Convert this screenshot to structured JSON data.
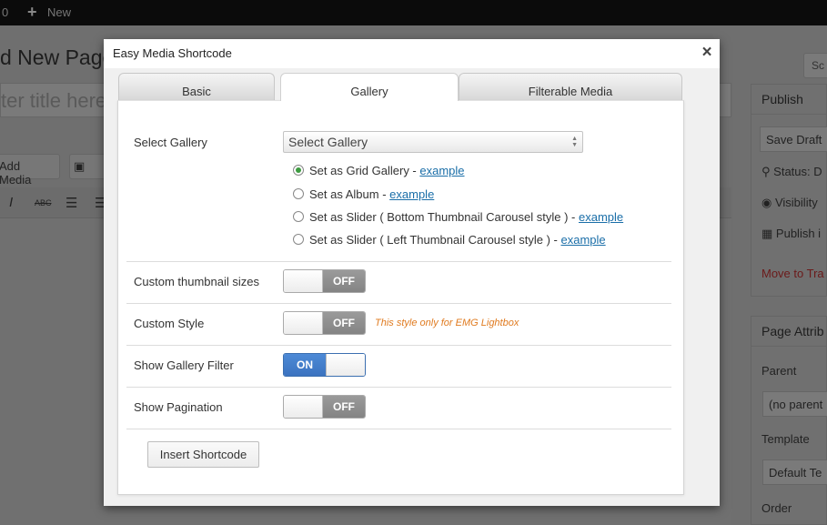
{
  "background": {
    "adminbar": {
      "count": "0",
      "new_label": "New"
    },
    "page_title": "d New Page",
    "title_placeholder": "ter title here",
    "add_media_label": "Add Media",
    "search_btn": "Sc",
    "publish_box": {
      "title": "Publish",
      "save_draft": "Save Draft",
      "status": "Status: D",
      "visibility": "Visibility",
      "publish": "Publish i",
      "trash": "Move to Tra"
    },
    "page_attributes": {
      "title": "Page Attrib",
      "parent_label": "Parent",
      "parent_value": "(no parent",
      "template_label": "Template",
      "template_value": "Default Te",
      "order_label": "Order"
    }
  },
  "modal": {
    "title": "Easy Media Shortcode",
    "close": "×",
    "tabs": [
      {
        "label": "Basic",
        "active": false
      },
      {
        "label": "Gallery",
        "active": true
      },
      {
        "label": "Filterable Media",
        "active": false
      }
    ],
    "select_gallery": {
      "label": "Select Gallery",
      "value": "Select Gallery"
    },
    "options": [
      {
        "label": "Set as Grid Gallery - ",
        "link": "example",
        "checked": true
      },
      {
        "label": "Set as Album - ",
        "link": "example",
        "checked": false
      },
      {
        "label": "Set as Slider ( Bottom Thumbnail Carousel style ) - ",
        "link": "example",
        "checked": false
      },
      {
        "label": "Set as Slider ( Left Thumbnail Carousel style ) - ",
        "link": "example",
        "checked": false
      }
    ],
    "custom_thumbnail": {
      "label": "Custom thumbnail sizes",
      "state": "OFF"
    },
    "custom_style": {
      "label": "Custom Style",
      "state": "OFF",
      "note": "This style only for EMG Lightbox"
    },
    "show_filter": {
      "label": "Show Gallery Filter",
      "state": "ON"
    },
    "show_pagination": {
      "label": "Show Pagination",
      "state": "OFF"
    },
    "insert_button": "Insert Shortcode"
  }
}
